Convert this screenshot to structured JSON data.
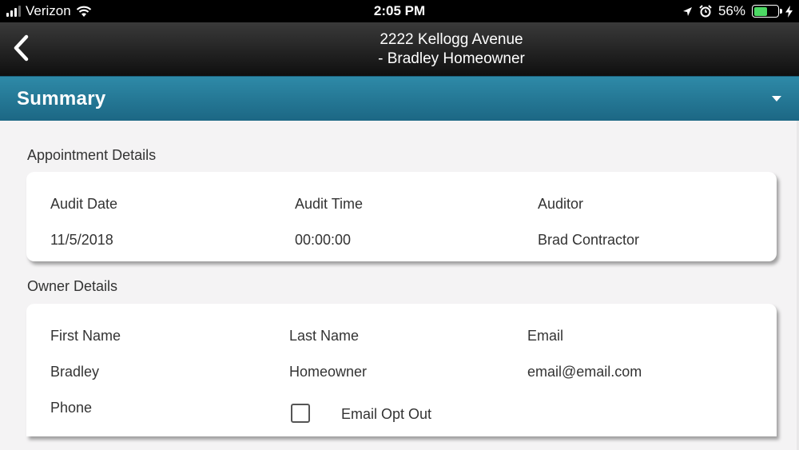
{
  "status_bar": {
    "carrier": "Verizon",
    "time": "2:05 PM",
    "battery_percent": "56%",
    "battery_level": 0.56,
    "battery_color": "#4cd964"
  },
  "header": {
    "title_line1": "2222 Kellogg Avenue",
    "title_line2": "-  Bradley Homeowner",
    "back_icon": "chevron-left-icon"
  },
  "summary": {
    "title": "Summary",
    "toggle_icon": "caret-down-icon",
    "bar_color": "#2a7f9e"
  },
  "appointment": {
    "section_title": "Appointment Details",
    "audit_date_label": "Audit Date",
    "audit_date": "11/5/2018",
    "audit_time_label": "Audit Time",
    "audit_time": "00:00:00",
    "auditor_label": "Auditor",
    "auditor": "Brad Contractor"
  },
  "owner": {
    "section_title": "Owner Details",
    "first_name_label": "First Name",
    "first_name": "Bradley",
    "last_name_label": "Last Name",
    "last_name": "Homeowner",
    "email_label": "Email",
    "email": "email@email.com",
    "phone_label": "Phone",
    "email_opt_out_label": "Email Opt Out",
    "email_opt_out_checked": false
  }
}
